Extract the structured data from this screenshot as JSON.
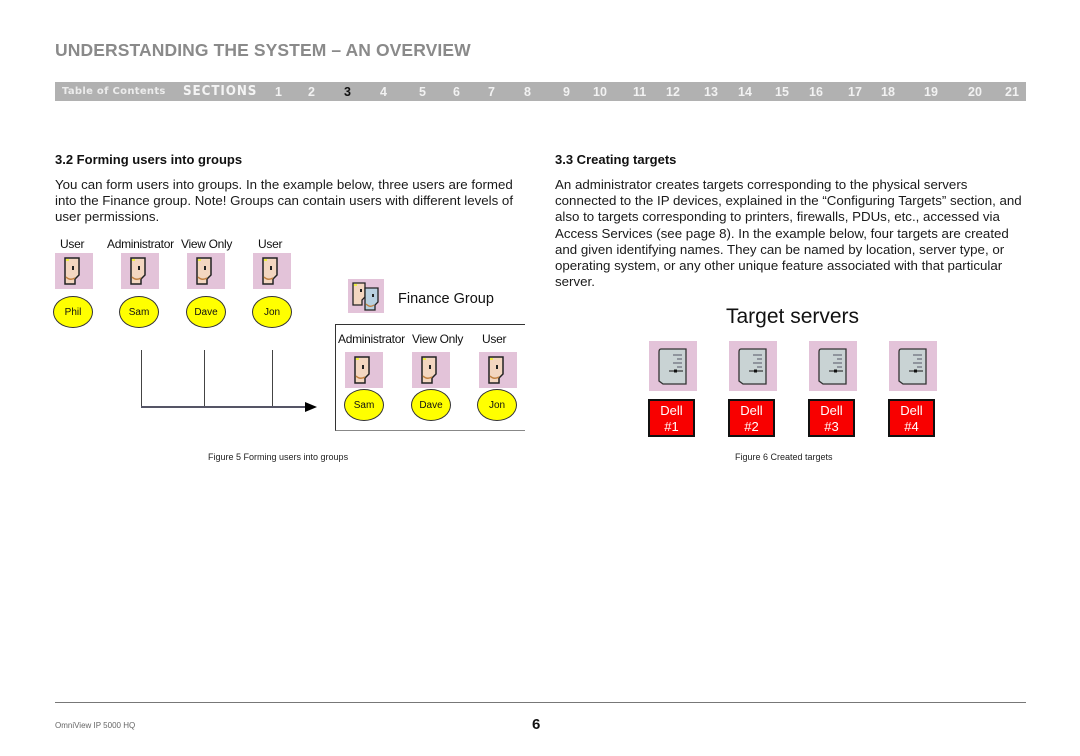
{
  "header": {
    "title": "UNDERSTANDING THE SYSTEM – AN OVERVIEW"
  },
  "nav": {
    "toc_label": "Table of Contents",
    "sections_label": "SECTIONS",
    "active_section": "3",
    "sections": [
      "1",
      "2",
      "3",
      "4",
      "5",
      "6",
      "7",
      "8",
      "9",
      "10",
      "11",
      "12",
      "13",
      "14",
      "15",
      "16",
      "17",
      "18",
      "19",
      "20",
      "21"
    ]
  },
  "left": {
    "heading": "3.2 Forming users into groups",
    "body": "You can form users into groups. In the example below, three users are formed into the Finance group. Note! Groups can contain users with different levels of user permissions.",
    "figure": {
      "users": [
        {
          "role": "User",
          "name": "Phil"
        },
        {
          "role": "Administrator",
          "name": "Sam"
        },
        {
          "role": "View Only",
          "name": "Dave"
        },
        {
          "role": "User",
          "name": "Jon"
        }
      ],
      "group_title": "Finance Group",
      "group_members": [
        {
          "role": "Administrator",
          "name": "Sam"
        },
        {
          "role": "View Only",
          "name": "Dave"
        },
        {
          "role": "User",
          "name": "Jon"
        }
      ],
      "icons": {
        "user": "user-face-icon",
        "group": "group-faces-icon"
      },
      "colors": {
        "icon_bg": "#e3c3d9",
        "circle_fill": "#ffff00"
      }
    },
    "caption": "Figure 5 Forming users into groups"
  },
  "right": {
    "heading": "3.3 Creating targets",
    "body": "An administrator creates targets corresponding to the physical servers connected to the IP devices, explained in the “Configuring Targets” section, and also to targets corresponding to printers, firewalls, PDUs, etc., accessed via Access Services (see page 8). In the example below, four targets are created and given identifying names. They can be named by location, server type, or operating system, or any other unique feature associated with that particular server.",
    "figure": {
      "title": "Target servers",
      "targets": [
        {
          "line1": "Dell",
          "line2": "#1"
        },
        {
          "line1": "Dell",
          "line2": "#2"
        },
        {
          "line1": "Dell",
          "line2": "#3"
        },
        {
          "line1": "Dell",
          "line2": "#4"
        }
      ],
      "icons": {
        "server": "server-icon"
      },
      "colors": {
        "target_box": "#f80000"
      }
    },
    "caption": "Figure 6 Created targets"
  },
  "footer": {
    "product": "OmniView IP 5000 HQ",
    "page_number": "6"
  }
}
